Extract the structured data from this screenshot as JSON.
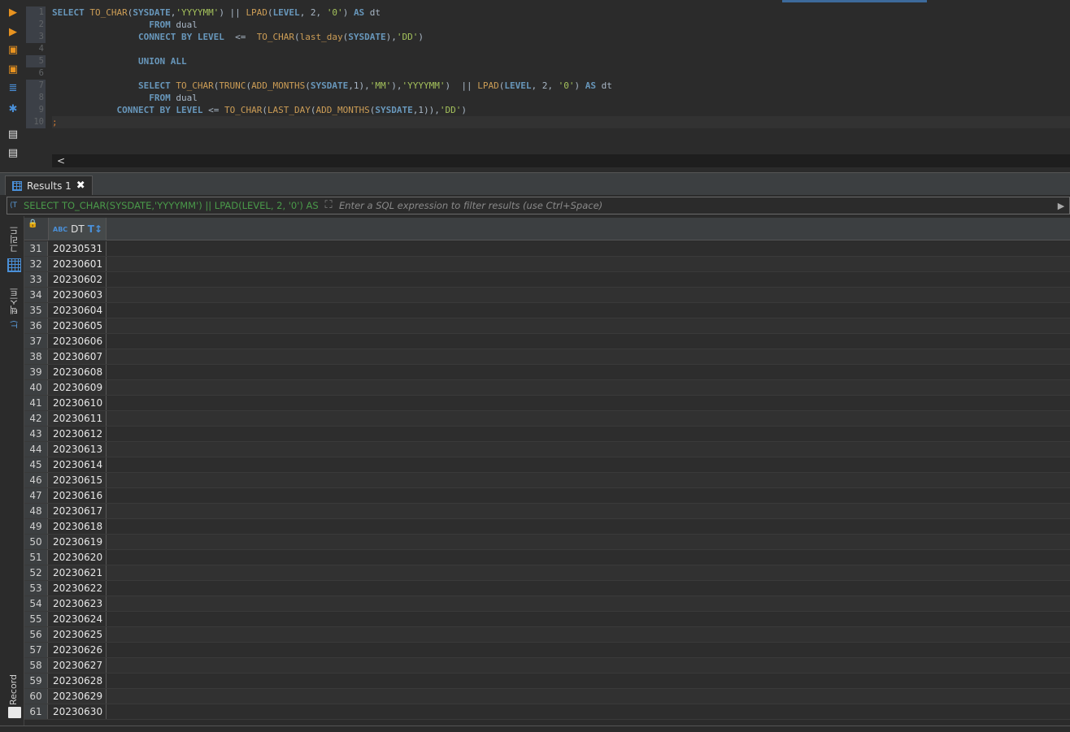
{
  "editor": {
    "line_numbers": [
      "1",
      "2",
      "3",
      "4",
      "5",
      "6",
      "7",
      "8",
      "9",
      "10"
    ],
    "code": [
      [
        [
          "kw",
          "SELECT "
        ],
        [
          "fn",
          "TO_CHAR"
        ],
        [
          "",
          "("
        ],
        [
          "kw",
          "SYSDATE"
        ],
        [
          "",
          ","
        ],
        [
          "str",
          "'YYYYMM'"
        ],
        [
          "",
          ") || "
        ],
        [
          "fn",
          "LPAD"
        ],
        [
          "",
          "("
        ],
        [
          "kw",
          "LEVEL"
        ],
        [
          "",
          ", 2, "
        ],
        [
          "str",
          "'0'"
        ],
        [
          "",
          ") "
        ],
        [
          "kw",
          "AS"
        ],
        [
          "",
          " dt"
        ]
      ],
      [
        [
          "",
          "                  "
        ],
        [
          "kw",
          "FROM"
        ],
        [
          "",
          " dual"
        ]
      ],
      [
        [
          "",
          "                "
        ],
        [
          "kw",
          "CONNECT BY LEVEL"
        ],
        [
          "",
          "  <=  "
        ],
        [
          "fn",
          "TO_CHAR"
        ],
        [
          "",
          "("
        ],
        [
          "fn",
          "last_day"
        ],
        [
          "",
          "("
        ],
        [
          "kw",
          "SYSDATE"
        ],
        [
          "",
          "),"
        ],
        [
          "str",
          "'DD'"
        ],
        [
          "",
          ")"
        ]
      ],
      [
        [
          "",
          ""
        ]
      ],
      [
        [
          "",
          "                "
        ],
        [
          "kw",
          "UNION ALL"
        ]
      ],
      [
        [
          "",
          ""
        ]
      ],
      [
        [
          "",
          "                "
        ],
        [
          "kw",
          "SELECT "
        ],
        [
          "fn",
          "TO_CHAR"
        ],
        [
          "",
          "("
        ],
        [
          "fn",
          "TRUNC"
        ],
        [
          "",
          "("
        ],
        [
          "fn",
          "ADD_MONTHS"
        ],
        [
          "",
          "("
        ],
        [
          "kw",
          "SYSDATE"
        ],
        [
          "",
          ",1),"
        ],
        [
          "str",
          "'MM'"
        ],
        [
          "",
          "),"
        ],
        [
          "str",
          "'YYYYMM'"
        ],
        [
          "",
          ")  || "
        ],
        [
          "fn",
          "LPAD"
        ],
        [
          "",
          "("
        ],
        [
          "kw",
          "LEVEL"
        ],
        [
          "",
          ", 2, "
        ],
        [
          "str",
          "'0'"
        ],
        [
          "",
          ") "
        ],
        [
          "kw",
          "AS"
        ],
        [
          "",
          " dt"
        ]
      ],
      [
        [
          "",
          "                  "
        ],
        [
          "kw",
          "FROM"
        ],
        [
          "",
          " dual"
        ]
      ],
      [
        [
          "",
          "            "
        ],
        [
          "kw",
          "CONNECT BY LEVEL"
        ],
        [
          "",
          " <= "
        ],
        [
          "fn",
          "TO_CHAR"
        ],
        [
          "",
          "("
        ],
        [
          "fn",
          "LAST_DAY"
        ],
        [
          "",
          "("
        ],
        [
          "fn",
          "ADD_MONTHS"
        ],
        [
          "",
          "("
        ],
        [
          "kw",
          "SYSDATE"
        ],
        [
          "",
          ",1)),"
        ],
        [
          "str",
          "'DD'"
        ],
        [
          "",
          ")"
        ]
      ],
      [
        [
          "sym",
          ";"
        ]
      ]
    ],
    "hscroll_arrow": "<"
  },
  "results_tab": {
    "label": "Results 1",
    "close": "✖"
  },
  "filter": {
    "sql_text": "SELECT TO_CHAR(SYSDATE,'YYYYMM') || LPAD(LEVEL, 2, '0') AS dt",
    "placeholder": "Enter a SQL expression to filter results (use Ctrl+Space)"
  },
  "left_panel": {
    "grid_label": "그리드",
    "text_label": "텍스트",
    "record_label": "Record"
  },
  "grid": {
    "column_header": "DT",
    "column_type_badge": "ABC",
    "rows": [
      {
        "n": "31",
        "v": "20230531"
      },
      {
        "n": "32",
        "v": "20230601"
      },
      {
        "n": "33",
        "v": "20230602"
      },
      {
        "n": "34",
        "v": "20230603"
      },
      {
        "n": "35",
        "v": "20230604"
      },
      {
        "n": "36",
        "v": "20230605"
      },
      {
        "n": "37",
        "v": "20230606"
      },
      {
        "n": "38",
        "v": "20230607"
      },
      {
        "n": "39",
        "v": "20230608"
      },
      {
        "n": "40",
        "v": "20230609"
      },
      {
        "n": "41",
        "v": "20230610"
      },
      {
        "n": "42",
        "v": "20230611"
      },
      {
        "n": "43",
        "v": "20230612"
      },
      {
        "n": "44",
        "v": "20230613"
      },
      {
        "n": "45",
        "v": "20230614"
      },
      {
        "n": "46",
        "v": "20230615"
      },
      {
        "n": "47",
        "v": "20230616"
      },
      {
        "n": "48",
        "v": "20230617"
      },
      {
        "n": "49",
        "v": "20230618"
      },
      {
        "n": "50",
        "v": "20230619"
      },
      {
        "n": "51",
        "v": "20230620"
      },
      {
        "n": "52",
        "v": "20230621"
      },
      {
        "n": "53",
        "v": "20230622"
      },
      {
        "n": "54",
        "v": "20230623"
      },
      {
        "n": "55",
        "v": "20230624"
      },
      {
        "n": "56",
        "v": "20230625"
      },
      {
        "n": "57",
        "v": "20230626"
      },
      {
        "n": "58",
        "v": "20230627"
      },
      {
        "n": "59",
        "v": "20230628"
      },
      {
        "n": "60",
        "v": "20230629"
      },
      {
        "n": "61",
        "v": "20230630"
      }
    ]
  },
  "colors": {
    "keyword": "#6897bb",
    "function": "#cc9d56",
    "string": "#a5c25c",
    "background": "#2b2b2b",
    "accent": "#4a90d9"
  }
}
